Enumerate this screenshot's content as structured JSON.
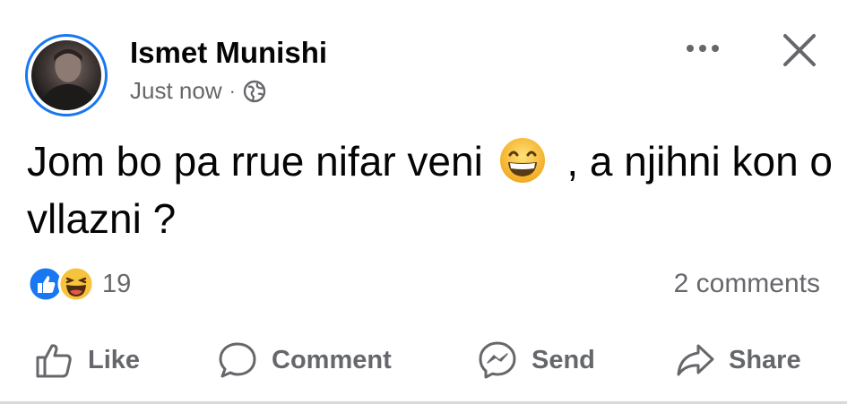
{
  "post": {
    "author": "Ismet Munishi",
    "time": "Just now",
    "separator": "·",
    "audience_icon": "globe-icon",
    "text_part1": "Jom bo pa rrue nifar veni",
    "emoji": "grinning-face-with-smiling-eyes",
    "text_part2": ", a njihni kon o vllazni ?",
    "reactions": {
      "icons": [
        "like-reaction-icon",
        "haha-reaction-icon"
      ],
      "count": "19"
    },
    "comments_count": "2 comments"
  },
  "actions": {
    "like": "Like",
    "comment": "Comment",
    "send": "Send",
    "share": "Share"
  },
  "colors": {
    "accent": "#1877f2",
    "secondary_text": "#65676b",
    "primary_text": "#050505"
  }
}
